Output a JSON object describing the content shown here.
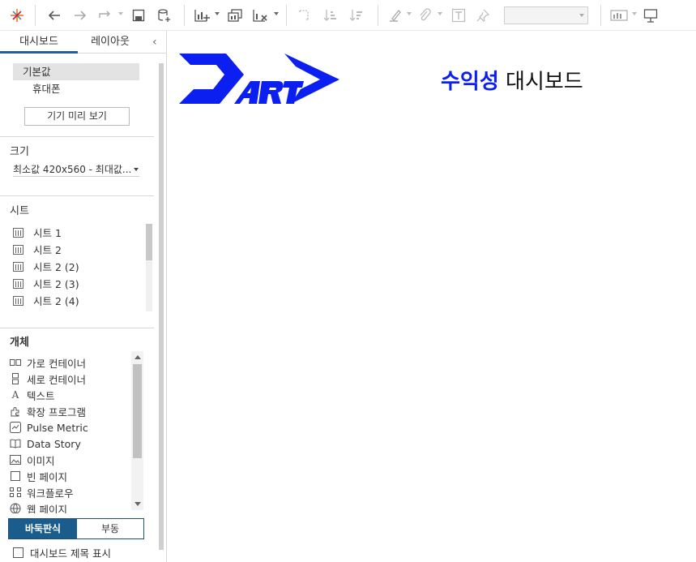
{
  "toolbar": {
    "icons": [
      "tableau-logo-icon",
      "undo-icon",
      "redo-icon",
      "replay-icon",
      "save-icon",
      "new-datasource-icon",
      "new-worksheet-icon",
      "duplicate-icon",
      "clear-icon",
      "swap-icon",
      "sort-ascending-icon",
      "sort-descending-icon",
      "highlight-icon",
      "attach-icon",
      "text-label-icon",
      "pin-icon",
      "show-me-icon",
      "presentation-icon"
    ]
  },
  "left_panel": {
    "tabs": [
      "대시보드",
      "레이아웃"
    ],
    "devices": {
      "default": "기본값",
      "phone": "휴대폰"
    },
    "preview_button": "기기 미리 보기",
    "size": {
      "heading": "크기",
      "value": "최소값 420x560 - 최대값..."
    },
    "sheets": {
      "heading": "시트",
      "items": [
        "시트 1",
        "시트 2",
        "시트 2 (2)",
        "시트 2 (3)",
        "시트 2 (4)"
      ]
    },
    "objects": {
      "heading": "개체",
      "items": [
        {
          "label": "가로 컨테이너",
          "icon": "horizontal-container-icon"
        },
        {
          "label": "세로 컨테이너",
          "icon": "vertical-container-icon"
        },
        {
          "label": "텍스트",
          "icon": "text-icon"
        },
        {
          "label": "확장 프로그램",
          "icon": "extension-icon"
        },
        {
          "label": "Pulse Metric",
          "icon": "pulse-metric-icon"
        },
        {
          "label": "Data Story",
          "icon": "data-story-icon"
        },
        {
          "label": "이미지",
          "icon": "image-icon"
        },
        {
          "label": "빈 페이지",
          "icon": "blank-icon"
        },
        {
          "label": "워크플로우",
          "icon": "workflow-icon"
        },
        {
          "label": "웹 페이지",
          "icon": "web-page-icon"
        }
      ]
    },
    "layout_mode": {
      "tiled": "바둑판식",
      "floating": "부동"
    },
    "show_title_label": "대시보드 제목 표시"
  },
  "canvas": {
    "title_accent": "수익성",
    "title_rest": " 대시보드",
    "logo_text": "DART",
    "accent_color": "#0b1ff0"
  }
}
